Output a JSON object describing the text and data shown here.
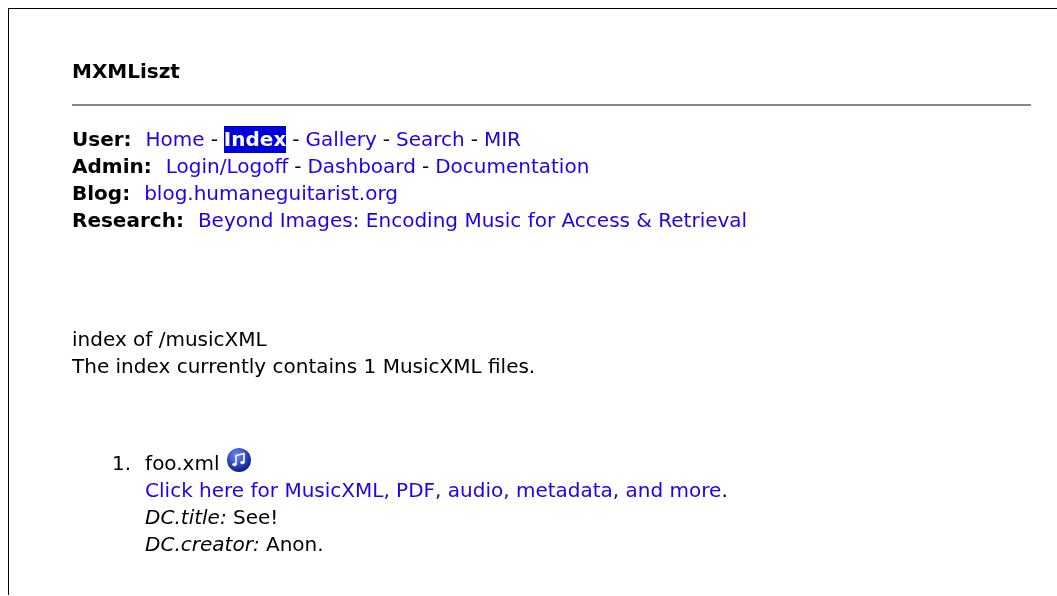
{
  "title": "MXMLiszt",
  "nav": [
    {
      "label": "User:",
      "links": [
        {
          "text": "Home",
          "selected": false
        },
        {
          "text": "Index",
          "selected": true
        },
        {
          "text": "Gallery",
          "selected": false
        },
        {
          "text": "Search",
          "selected": false
        },
        {
          "text": "MIR",
          "selected": false
        }
      ]
    },
    {
      "label": "Admin:",
      "links": [
        {
          "text": "Login/Logoff",
          "selected": false
        },
        {
          "text": "Dashboard",
          "selected": false
        },
        {
          "text": "Documentation",
          "selected": false
        }
      ]
    },
    {
      "label": "Blog:",
      "links": [
        {
          "text": "blog.humaneguitarist.org",
          "selected": false
        }
      ]
    },
    {
      "label": "Research:",
      "links": [
        {
          "text": "Beyond Images: Encoding Music for Access & Retrieval",
          "selected": false
        }
      ]
    }
  ],
  "separator": "-",
  "heading": "index of /musicXML",
  "summary": "The index currently contains 1 MusicXML files.",
  "files": [
    {
      "number": "1.",
      "name": "foo.xml",
      "link": "Click here for MusicXML, PDF, audio, metadata, and more",
      "link_after": ".",
      "metadata": [
        "*DC.title:* See!",
        "*DC.creator:* Anon."
      ]
    }
  ]
}
